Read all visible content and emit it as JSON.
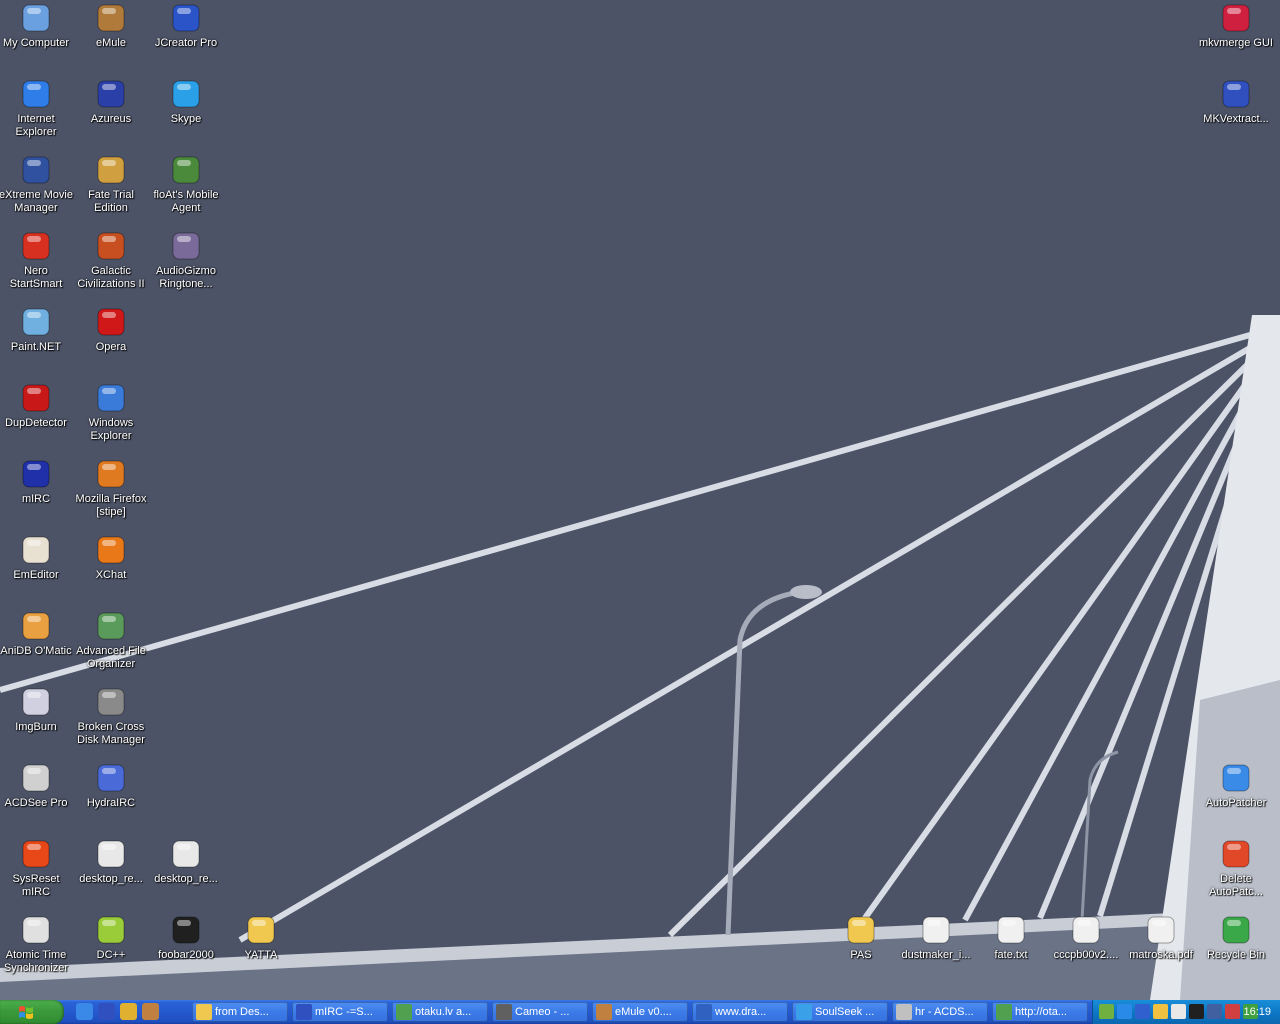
{
  "desktop": {
    "icons_left": [
      {
        "label": "My Computer",
        "icon": "my-computer-icon",
        "color": "#6aa0e0"
      },
      {
        "label": "eMule",
        "icon": "emule-icon",
        "color": "#b07a3a"
      },
      {
        "label": "JCreator Pro",
        "icon": "jcreator-icon",
        "color": "#2a54c8"
      },
      {
        "label": "Internet Explorer",
        "icon": "internet-explorer-icon",
        "color": "#2f7de8"
      },
      {
        "label": "Azureus",
        "icon": "azureus-icon",
        "color": "#2a3fa8"
      },
      {
        "label": "Skype",
        "icon": "skype-icon",
        "color": "#2aa0e8"
      },
      {
        "label": "eXtreme Movie Manager",
        "icon": "movie-manager-icon",
        "color": "#3050a0"
      },
      {
        "label": "Fate Trial Edition",
        "icon": "fate-icon",
        "color": "#d0a040"
      },
      {
        "label": "floAt's Mobile Agent",
        "icon": "float-mobile-agent-icon",
        "color": "#4a8a3a"
      },
      {
        "label": "Nero StartSmart",
        "icon": "nero-icon",
        "color": "#d83020"
      },
      {
        "label": "Galactic Civilizations II",
        "icon": "galciv-icon",
        "color": "#c85020"
      },
      {
        "label": "AudioGizmo Ringtone...",
        "icon": "audiogizmo-icon",
        "color": "#7a6a9a"
      },
      {
        "label": "Paint.NET",
        "icon": "paint-net-icon",
        "color": "#70b0e0"
      },
      {
        "label": "Opera",
        "icon": "opera-icon",
        "color": "#d01818"
      },
      {
        "label": "DupDetector",
        "icon": "dupdetector-icon",
        "color": "#c81818"
      },
      {
        "label": "Windows Explorer",
        "icon": "windows-explorer-icon",
        "color": "#3a7ad8"
      },
      {
        "label": "mIRC",
        "icon": "mirc-icon",
        "color": "#2030a8"
      },
      {
        "label": "Mozilla Firefox [stipe]",
        "icon": "firefox-icon",
        "color": "#e07a20"
      },
      {
        "label": "EmEditor",
        "icon": "emeditor-icon",
        "color": "#e8e0d0"
      },
      {
        "label": "XChat",
        "icon": "xchat-icon",
        "color": "#e87818"
      },
      {
        "label": "AniDB O'Matic",
        "icon": "anidb-icon",
        "color": "#e8a040"
      },
      {
        "label": "Advanced File Organizer",
        "icon": "file-organizer-icon",
        "color": "#5a9a5a"
      },
      {
        "label": "ImgBurn",
        "icon": "imgburn-icon",
        "color": "#d0d0e0"
      },
      {
        "label": "Broken Cross Disk Manager",
        "icon": "disk-manager-icon",
        "color": "#8a8a8a"
      },
      {
        "label": "ACDSee Pro",
        "icon": "acdsee-icon",
        "color": "#d0d0d0"
      },
      {
        "label": "HydraIRC",
        "icon": "hydrairc-icon",
        "color": "#4a6ad8"
      },
      {
        "label": "SysReset mIRC",
        "icon": "sysreset-icon",
        "color": "#e84818"
      },
      {
        "label": "desktop_re...",
        "icon": "png-file-icon",
        "color": "#e8e8e8"
      },
      {
        "label": "desktop_re...",
        "icon": "jpg-file-icon",
        "color": "#e8e8e8"
      },
      {
        "label": "Atomic Time Synchronizer",
        "icon": "atomic-time-icon",
        "color": "#e0e0e0"
      },
      {
        "label": "DC++",
        "icon": "dcpp-icon",
        "color": "#9acc3a"
      },
      {
        "label": "foobar2000",
        "icon": "foobar-icon",
        "color": "#202020"
      },
      {
        "label": "YATTA",
        "icon": "folder-icon",
        "color": "#f0c850"
      }
    ],
    "icons_right": [
      {
        "label": "mkvmerge GUI",
        "icon": "mkvmerge-icon",
        "color": "#d02040"
      },
      {
        "label": "MKVextract...",
        "icon": "mkvextract-icon",
        "color": "#3050c0"
      },
      {
        "label": "AutoPatcher",
        "icon": "autopatcher-icon",
        "color": "#3a8ae8"
      },
      {
        "label": "Delete AutoPatc...",
        "icon": "delete-autopatcher-icon",
        "color": "#e04828"
      },
      {
        "label": "PAS",
        "icon": "folder-icon",
        "color": "#f0c850"
      },
      {
        "label": "dustmaker_i...",
        "icon": "txt-file-icon",
        "color": "#f0f0f0"
      },
      {
        "label": "fate.txt",
        "icon": "txt-file-icon",
        "color": "#f0f0f0"
      },
      {
        "label": "cccpb00v2....",
        "icon": "gif-file-icon",
        "color": "#f0f0f0"
      },
      {
        "label": "matroska.pdf",
        "icon": "pdf-file-icon",
        "color": "#f0f0f0"
      },
      {
        "label": "Recycle Bin",
        "icon": "recycle-bin-icon",
        "color": "#3aa848"
      }
    ]
  },
  "taskbar": {
    "start_label": "start",
    "quick_launch": [
      {
        "icon": "ie-quick-icon",
        "color": "#3a88e8"
      },
      {
        "icon": "mirc-quick-icon",
        "color": "#3050c0"
      },
      {
        "icon": "winamp-quick-icon",
        "color": "#e0b030"
      },
      {
        "icon": "emule-quick-icon",
        "color": "#c08040"
      }
    ],
    "tasks": [
      {
        "label": "from Des...",
        "icon": "folder-icon",
        "color": "#f0c850"
      },
      {
        "label": "mIRC -=S...",
        "icon": "mirc-icon",
        "color": "#3050c0"
      },
      {
        "label": "otaku.lv a...",
        "icon": "browser-icon",
        "color": "#50a050"
      },
      {
        "label": "Cameo - ...",
        "icon": "cameo-icon",
        "color": "#606060"
      },
      {
        "label": "eMule v0....",
        "icon": "emule-icon",
        "color": "#c08040"
      },
      {
        "label": "www.dra...",
        "icon": "browser-icon",
        "color": "#3060c0"
      },
      {
        "label": "SoulSeek ...",
        "icon": "soulseek-icon",
        "color": "#3aa0e8"
      },
      {
        "label": "hr - ACDS...",
        "icon": "acdsee-icon",
        "color": "#c0c0c0"
      },
      {
        "label": "http://ota...",
        "icon": "browser-icon",
        "color": "#50a050"
      }
    ],
    "tray_icons": [
      {
        "icon": "back-arrow-icon",
        "color": "#70b040"
      },
      {
        "icon": "soulseek-tray-icon",
        "color": "#2a8ae8"
      },
      {
        "icon": "shield-tray-icon",
        "color": "#3060d0"
      },
      {
        "icon": "sun-tray-icon",
        "color": "#f0c040"
      },
      {
        "icon": "display-tray-icon",
        "color": "#e8e8e8"
      },
      {
        "icon": "phone-tray-icon",
        "color": "#202020"
      },
      {
        "icon": "network-tray-icon",
        "color": "#4060a0"
      },
      {
        "icon": "users-tray-icon",
        "color": "#d04040"
      },
      {
        "icon": "globe-tray-icon",
        "color": "#40a040"
      }
    ],
    "clock": "16:19"
  },
  "colors": {
    "background": "#4c5366",
    "taskbar": "#2559cf",
    "start": "#3c9a3c",
    "tray": "#0e78c6"
  }
}
